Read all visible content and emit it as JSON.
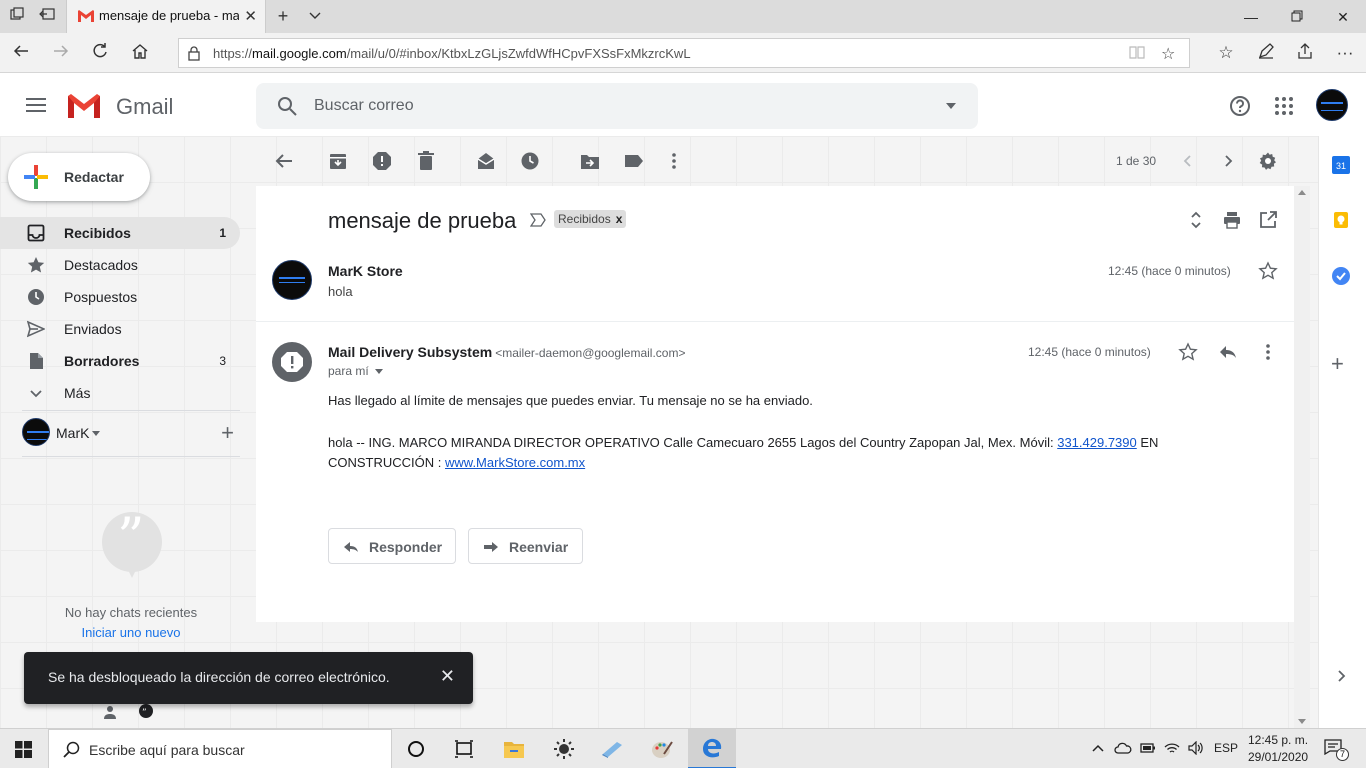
{
  "browser": {
    "tab_title": "mensaje de prueba - ma",
    "url_prefix": "https://",
    "url_host": "mail.google.com",
    "url_path": "/mail/u/0/#inbox/KtbxLzGLjsZwfdWfHCpvFXSsFxMkzrcKwL"
  },
  "gmail": {
    "brand": "Gmail",
    "search_placeholder": "Buscar correo",
    "compose_label": "Redactar",
    "nav": [
      {
        "label": "Recibidos",
        "count": "1"
      },
      {
        "label": "Destacados",
        "count": ""
      },
      {
        "label": "Pospuestos",
        "count": ""
      },
      {
        "label": "Enviados",
        "count": ""
      },
      {
        "label": "Borradores",
        "count": "3"
      },
      {
        "label": "Más",
        "count": ""
      }
    ],
    "hangouts_user": "MarK",
    "no_chats": "No hay chats recientes",
    "start_chat": "Iniciar uno nuevo",
    "pager": "1 de 30"
  },
  "thread": {
    "subject": "mensaje de prueba",
    "label_chip": "Recibidos",
    "label_chip_close": "x",
    "messages": [
      {
        "sender": "MarK Store",
        "address": "",
        "snippet": "hola",
        "time": "12:45 (hace 0 minutos)"
      },
      {
        "sender": "Mail Delivery Subsystem",
        "address": "<mailer-daemon@googlemail.com>",
        "to": "para mí",
        "time": "12:45 (hace 0 minutos)",
        "body_line1": "Has llegado al límite de mensajes que puedes enviar. Tu mensaje no se ha enviado.",
        "body_line2_part1": "hola -- ING. MARCO MIRANDA DIRECTOR OPERATIVO Calle Camecuaro 2655 Lagos del Country Zapopan Jal, Mex. Móvil: ",
        "body_phone": "331.429.7390",
        "body_line2_part2": " EN CONSTRUCCIÓN : ",
        "body_link": "www.MarkStore.com.mx"
      }
    ],
    "reply_label": "Responder",
    "forward_label": "Reenviar"
  },
  "snackbar": {
    "message": "Se ha desbloqueado la dirección de correo electrónico.",
    "close": "✕"
  },
  "sidepanel": {
    "calendar_day": "31"
  },
  "taskbar": {
    "search_placeholder": "Escribe aquí para buscar",
    "lang": "ESP",
    "time": "12:45 p. m.",
    "date": "29/01/2020",
    "notification_count": "7"
  },
  "colors": {
    "gmail_red": "#ea4335",
    "link_blue": "#1155cc",
    "snackbar_bg": "#202124",
    "edge_blue": "#2878d6"
  }
}
